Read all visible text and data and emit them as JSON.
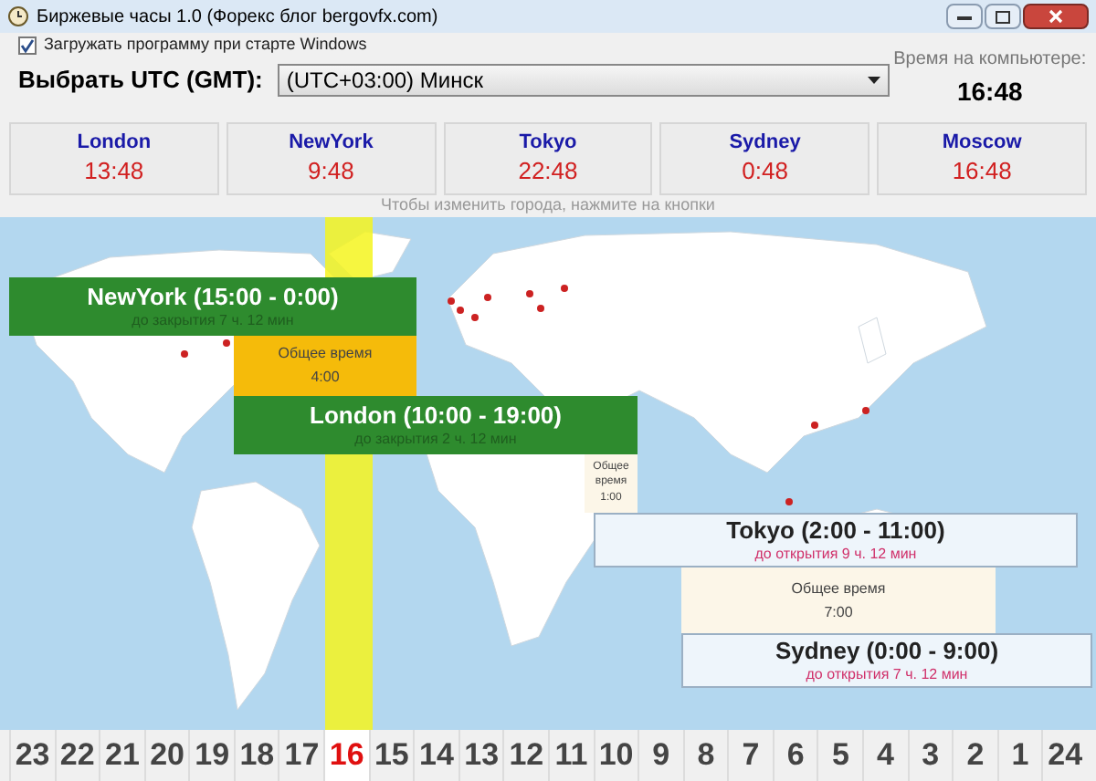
{
  "window": {
    "title": "Биржевые часы 1.0 (Форекс блог bergovfx.com)"
  },
  "autostart": {
    "label": "Загружать программу при старте Windows",
    "checked": true
  },
  "utc": {
    "label": "Выбрать UTC (GMT):",
    "value": "(UTC+03:00) Минск"
  },
  "computer_time": {
    "label": "Время на компьютере:",
    "value": "16:48"
  },
  "cities": [
    {
      "name": "London",
      "time": "13:48"
    },
    {
      "name": "NewYork",
      "time": "9:48"
    },
    {
      "name": "Tokyo",
      "time": "22:48"
    },
    {
      "name": "Sydney",
      "time": "0:48"
    },
    {
      "name": "Moscow",
      "time": "16:48"
    }
  ],
  "hint": "Чтобы изменить города, нажмите на кнопки",
  "sessions": [
    {
      "title": "NewYork (15:00 - 0:00)",
      "countdown": "до закрытия 7 ч. 12 мин",
      "open": true
    },
    {
      "title": "London (10:00 - 19:00)",
      "countdown": "до закрытия 2 ч. 12 мин",
      "open": true
    },
    {
      "title": "Tokyo (2:00 - 11:00)",
      "countdown": "до открытия 9 ч. 12 мин",
      "open": false
    },
    {
      "title": "Sydney (0:00 - 9:00)",
      "countdown": "до открытия 7 ч. 12 мин",
      "open": false
    }
  ],
  "overlaps": [
    {
      "label": "Общее время",
      "value": "4:00",
      "kind": "active"
    },
    {
      "label": "Общее время",
      "value": "1:00",
      "kind": "idle"
    },
    {
      "label": "Общее время",
      "value": "7:00",
      "kind": "idle"
    }
  ],
  "hours": [
    {
      "label": "23",
      "selected": false
    },
    {
      "label": "22",
      "selected": false
    },
    {
      "label": "21",
      "selected": false
    },
    {
      "label": "20",
      "selected": false
    },
    {
      "label": "19",
      "selected": false
    },
    {
      "label": "18",
      "selected": false
    },
    {
      "label": "17",
      "selected": false
    },
    {
      "label": "16",
      "selected": true
    },
    {
      "label": "15",
      "selected": false
    },
    {
      "label": "14",
      "selected": false
    },
    {
      "label": "13",
      "selected": false
    },
    {
      "label": "12",
      "selected": false
    },
    {
      "label": "11",
      "selected": false
    },
    {
      "label": "10",
      "selected": false
    },
    {
      "label": "9",
      "selected": false
    },
    {
      "label": "8",
      "selected": false
    },
    {
      "label": "7",
      "selected": false
    },
    {
      "label": "6",
      "selected": false
    },
    {
      "label": "5",
      "selected": false
    },
    {
      "label": "4",
      "selected": false
    },
    {
      "label": "3",
      "selected": false
    },
    {
      "label": "2",
      "selected": false
    },
    {
      "label": "1",
      "selected": false
    },
    {
      "label": "24",
      "selected": false
    }
  ]
}
